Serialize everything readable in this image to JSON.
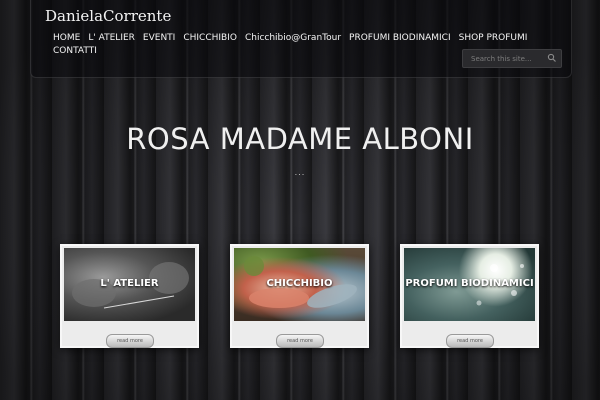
{
  "site": {
    "logo_text": "DanielaCorrente"
  },
  "nav": {
    "items": [
      {
        "label": "HOME"
      },
      {
        "label": "L' ATELIER"
      },
      {
        "label": "EVENTI"
      },
      {
        "label": "CHICCHIBIO"
      },
      {
        "label": "Chicchibio@GranTour"
      },
      {
        "label": "PROFUMI BIODINAMICI"
      },
      {
        "label": "SHOP PROFUMI"
      },
      {
        "label": "CONTATTI"
      }
    ]
  },
  "search": {
    "placeholder": "Search this site..."
  },
  "hero": {
    "title": "ROSA MADAME ALBONI",
    "separator": "..."
  },
  "cards": [
    {
      "caption": "L' ATELIER",
      "button_label": "read more"
    },
    {
      "caption": "CHICCHIBIO",
      "button_label": "read more"
    },
    {
      "caption": "PROFUMI BIODINAMICI",
      "button_label": "read more"
    }
  ],
  "colors": {
    "text": "#f0f0f0",
    "header_bg": "#0a0a0c"
  }
}
